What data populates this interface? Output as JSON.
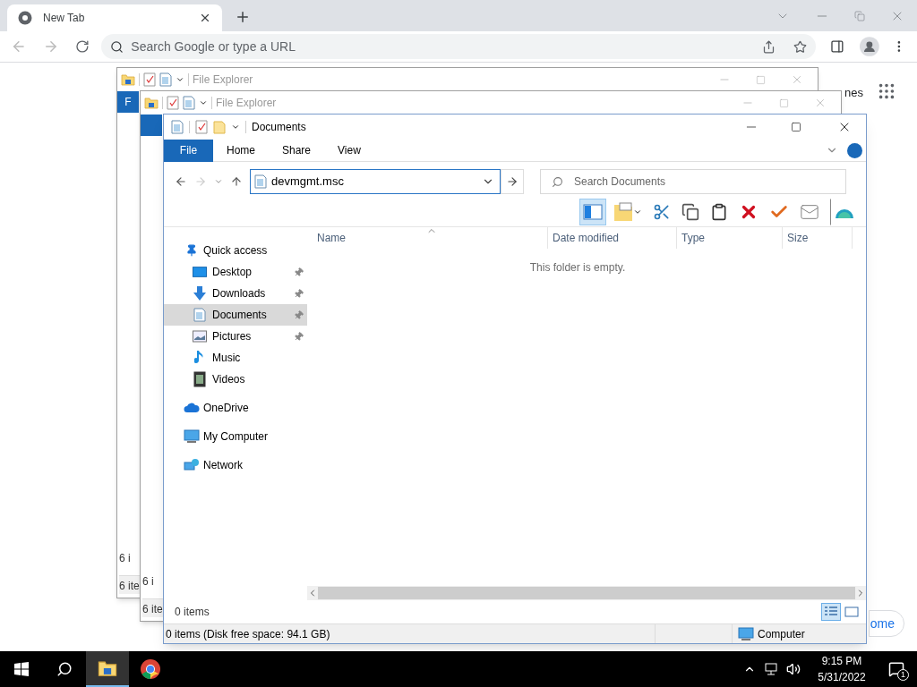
{
  "browser": {
    "tab": {
      "title": "New Tab"
    },
    "omnibox": {
      "placeholder": "Search Google or type a URL"
    },
    "page_texts": [
      "nes",
      "ome"
    ]
  },
  "windows_behind": [
    {
      "title": "File Explorer",
      "ribbon_tab": "F",
      "status_texts": [
        "6 i",
        "6 ite"
      ]
    },
    {
      "title": "File Explorer",
      "status_texts": [
        "6 i",
        "6 ite"
      ]
    }
  ],
  "explorer": {
    "title": "Documents",
    "ribbon_tabs": [
      {
        "label": "File",
        "selected": true
      },
      {
        "label": "Home",
        "selected": false
      },
      {
        "label": "Share",
        "selected": false
      },
      {
        "label": "View",
        "selected": false
      }
    ],
    "address": {
      "value": "devmgmt.msc"
    },
    "search": {
      "placeholder": "Search Documents"
    },
    "toolbar_buttons": [
      {
        "selected": true
      },
      {
        "selected": false
      },
      {
        "selected": false
      },
      {
        "selected": false
      },
      {
        "selected": false
      },
      {
        "selected": false
      },
      {
        "selected": false
      },
      {
        "selected": false
      },
      {
        "selected": false
      }
    ],
    "nav": [
      {
        "label": "Quick access",
        "children": [
          {
            "label": "Desktop",
            "pinned": true,
            "selected": false
          },
          {
            "label": "Downloads",
            "pinned": true,
            "selected": false
          },
          {
            "label": "Documents",
            "pinned": true,
            "selected": true
          },
          {
            "label": "Pictures",
            "pinned": true,
            "selected": false
          },
          {
            "label": "Music",
            "pinned": false,
            "selected": false
          },
          {
            "label": "Videos",
            "pinned": false,
            "selected": false
          }
        ]
      },
      {
        "label": "OneDrive"
      },
      {
        "label": "My Computer"
      },
      {
        "label": "Network"
      }
    ],
    "columns": [
      "Name",
      "Date modified",
      "Type",
      "Size"
    ],
    "empty_message": "This folder is empty.",
    "item_count": "0 items",
    "view_buttons": [
      {
        "selected": true
      },
      {
        "selected": false
      }
    ],
    "status_bar": {
      "text": "0 items (Disk free space: 94.1 GB)",
      "location": "Computer"
    }
  },
  "taskbar": {
    "time": "9:15 PM",
    "date": "5/31/2022",
    "notifications": "1"
  }
}
